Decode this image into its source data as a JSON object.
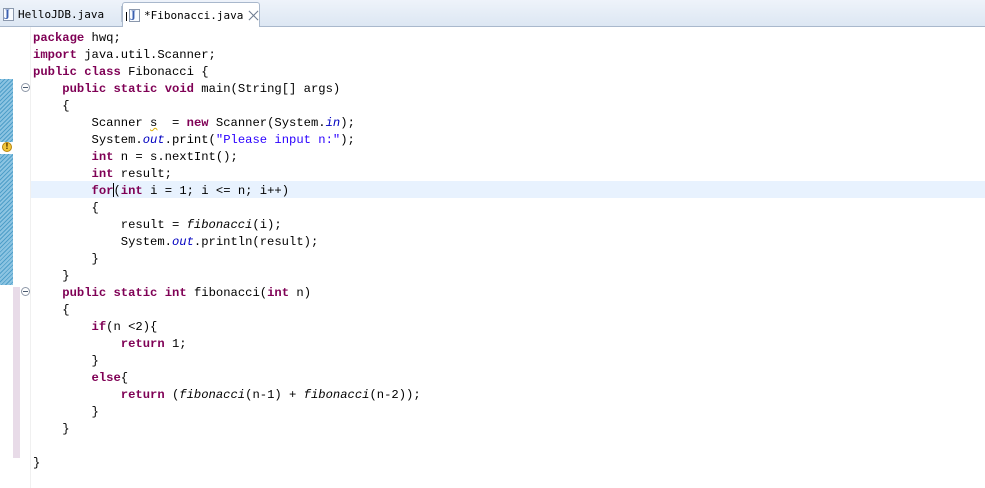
{
  "tabs": [
    {
      "label": "HelloJDB.java",
      "active": false
    },
    {
      "label": "*Fibonacci.java",
      "active": true
    }
  ],
  "colors": {
    "keyword": "#7f0055",
    "string": "#2a00ff",
    "static_field": "#0000c0",
    "current_line": "#e8f2fe",
    "annotation_bar": "#4f9fc9",
    "fold_band": "#e8dbe8"
  },
  "icons": {
    "java_file": "java-file-icon",
    "warning": "warning-icon",
    "fold": "fold-toggle-icon",
    "close": "close-icon"
  },
  "editor": {
    "current_line": 10,
    "lines": [
      [
        {
          "t": "package",
          "c": "kw"
        },
        {
          "t": " hwq;"
        }
      ],
      [
        {
          "t": "import",
          "c": "kw"
        },
        {
          "t": " java.util.Scanner;"
        }
      ],
      [
        {
          "t": "public",
          "c": "kw"
        },
        {
          "t": " "
        },
        {
          "t": "class",
          "c": "kw"
        },
        {
          "t": " Fibonacci {"
        }
      ],
      [
        {
          "t": "    "
        },
        {
          "t": "public",
          "c": "kw"
        },
        {
          "t": " "
        },
        {
          "t": "static",
          "c": "kw"
        },
        {
          "t": " "
        },
        {
          "t": "void",
          "c": "kw"
        },
        {
          "t": " main(String[] args)"
        }
      ],
      [
        {
          "t": "    {"
        }
      ],
      [
        {
          "t": "        Scanner "
        },
        {
          "t": "s",
          "c": "warnline"
        },
        {
          "t": "  = "
        },
        {
          "t": "new",
          "c": "kw"
        },
        {
          "t": " Scanner(System."
        },
        {
          "t": "in",
          "c": "fld"
        },
        {
          "t": ");"
        }
      ],
      [
        {
          "t": "        System."
        },
        {
          "t": "out",
          "c": "fld"
        },
        {
          "t": ".print("
        },
        {
          "t": "\"Please input n:\"",
          "c": "str"
        },
        {
          "t": ");"
        }
      ],
      [
        {
          "t": "        "
        },
        {
          "t": "int",
          "c": "kw"
        },
        {
          "t": " n = s.nextInt();"
        }
      ],
      [
        {
          "t": "        "
        },
        {
          "t": "int",
          "c": "kw"
        },
        {
          "t": " result;"
        }
      ],
      [
        {
          "t": "        "
        },
        {
          "t": "for",
          "c": "kw"
        },
        {
          "t": "",
          "c": "caret"
        },
        {
          "t": "("
        },
        {
          "t": "int",
          "c": "kw"
        },
        {
          "t": " i = 1; i <= n; i++)"
        }
      ],
      [
        {
          "t": "        {"
        }
      ],
      [
        {
          "t": "            result = "
        },
        {
          "t": "fibonacci",
          "c": "sm"
        },
        {
          "t": "(i);"
        }
      ],
      [
        {
          "t": "            System."
        },
        {
          "t": "out",
          "c": "fld"
        },
        {
          "t": ".println(result);"
        }
      ],
      [
        {
          "t": "        }"
        }
      ],
      [
        {
          "t": "    }"
        }
      ],
      [
        {
          "t": "    "
        },
        {
          "t": "public",
          "c": "kw"
        },
        {
          "t": " "
        },
        {
          "t": "static",
          "c": "kw"
        },
        {
          "t": " "
        },
        {
          "t": "int",
          "c": "kw"
        },
        {
          "t": " fibonacci("
        },
        {
          "t": "int",
          "c": "kw"
        },
        {
          "t": " n)"
        }
      ],
      [
        {
          "t": "    {"
        }
      ],
      [
        {
          "t": "        "
        },
        {
          "t": "if",
          "c": "kw"
        },
        {
          "t": "(n <2){"
        }
      ],
      [
        {
          "t": "            "
        },
        {
          "t": "return",
          "c": "kw"
        },
        {
          "t": " 1;"
        }
      ],
      [
        {
          "t": "        }"
        }
      ],
      [
        {
          "t": "        "
        },
        {
          "t": "else",
          "c": "kw"
        },
        {
          "t": "{"
        }
      ],
      [
        {
          "t": "            "
        },
        {
          "t": "return",
          "c": "kw"
        },
        {
          "t": " ("
        },
        {
          "t": "fibonacci",
          "c": "sm"
        },
        {
          "t": "(n-1) + "
        },
        {
          "t": "fibonacci",
          "c": "sm"
        },
        {
          "t": "(n-2));"
        }
      ],
      [
        {
          "t": "        }"
        }
      ],
      [
        {
          "t": "    }"
        }
      ],
      [
        {
          "t": ""
        }
      ],
      [
        {
          "t": "}"
        }
      ]
    ]
  }
}
